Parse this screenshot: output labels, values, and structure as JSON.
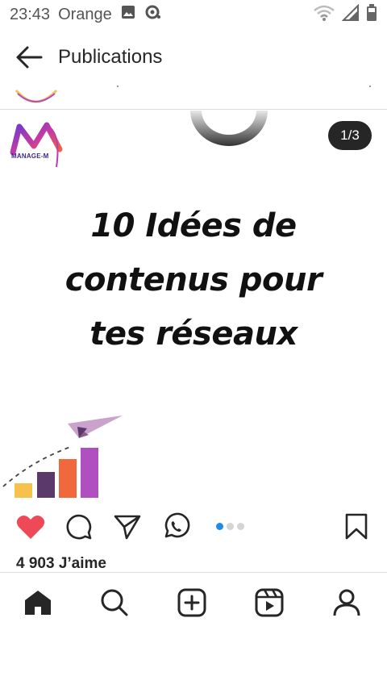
{
  "status_bar": {
    "time": "23:43",
    "carrier": "Orange",
    "icons": [
      "gallery-icon",
      "sync-icon",
      "wifi-icon",
      "signal-icon",
      "battery-icon"
    ]
  },
  "header": {
    "title": "Publications",
    "back_icon": "arrow-left-icon"
  },
  "post": {
    "image": {
      "logo_text": "MANAGE-M",
      "headline_lines": [
        "10 Idées de",
        "contenus pour",
        "tes réseaux"
      ],
      "colors": {
        "bar_yellow": "#f7c14e",
        "bar_purple": "#5b3a6b",
        "bar_orange": "#f2683d",
        "bar_violet": "#b04fc0",
        "plane": "#c9a3cb"
      }
    },
    "slide": {
      "current": 1,
      "total": 3,
      "counter_text": "1/3"
    },
    "actions": [
      "heart-icon",
      "comment-icon",
      "share-icon",
      "whatsapp-icon",
      "bookmark-icon"
    ],
    "likes_text": "4 903 J’aime",
    "colors": {
      "heart": "#ed4956",
      "active_dot": "#1e8ce6"
    }
  },
  "bottom_nav": {
    "items": [
      "home-icon",
      "search-icon",
      "add-post-icon",
      "reels-icon",
      "profile-icon"
    ]
  }
}
